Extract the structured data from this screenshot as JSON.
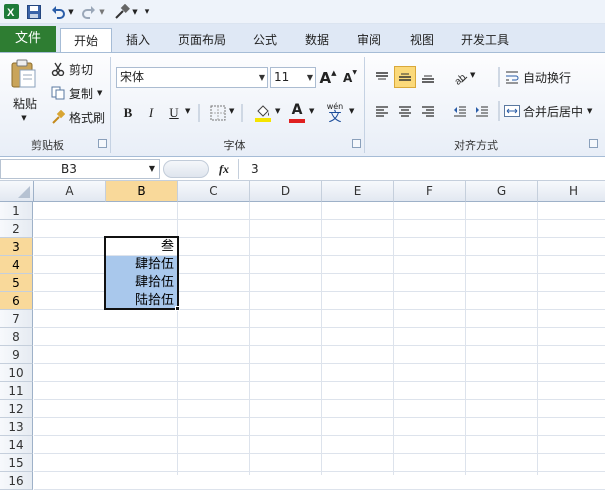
{
  "qat": {
    "icons": [
      "excel-logo-icon",
      "save-icon",
      "undo-icon",
      "redo-icon",
      "format-painter-icon",
      "customize-icon"
    ]
  },
  "tabs": {
    "file": "文件",
    "items": [
      "开始",
      "插入",
      "页面布局",
      "公式",
      "数据",
      "审阅",
      "视图",
      "开发工具"
    ],
    "active": "开始"
  },
  "ribbon": {
    "clipboard": {
      "paste": "粘贴",
      "cut": "剪切",
      "copy": "复制",
      "format_painter": "格式刷",
      "label": "剪贴板"
    },
    "font": {
      "name": "宋体",
      "size": "11",
      "grow": "A",
      "shrink": "A",
      "bold": "B",
      "italic": "I",
      "underline": "U",
      "font_color_letter": "A",
      "phonetic": "wén",
      "phonetic_char": "文",
      "label": "字体",
      "fill_color": "#f5e400",
      "font_color": "#e02020"
    },
    "alignment": {
      "wrap_text": "自动换行",
      "merge_center": "合并后居中",
      "label": "对齐方式"
    }
  },
  "formula_bar": {
    "name_box": "B3",
    "fx": "fx",
    "value": "3"
  },
  "sheet": {
    "columns": [
      "A",
      "B",
      "C",
      "D",
      "E",
      "F",
      "G",
      "H"
    ],
    "selected_column": "B",
    "rows": [
      "1",
      "2",
      "3",
      "4",
      "5",
      "6",
      "7",
      "8",
      "9",
      "10",
      "11",
      "12",
      "13",
      "14",
      "15",
      "16"
    ],
    "selected_rows": [
      "3",
      "4",
      "5",
      "6"
    ],
    "cells": {
      "B3": "叁",
      "B4": "肆拾伍",
      "B5": "肆拾伍",
      "B6": "陆拾伍"
    },
    "selection_color": "#a9c8ec"
  }
}
